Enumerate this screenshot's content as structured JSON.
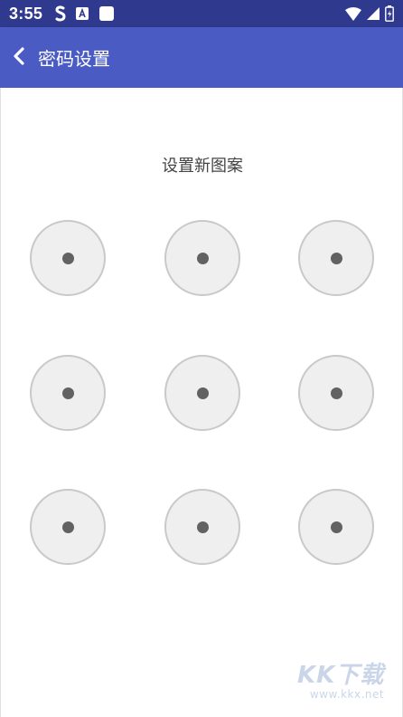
{
  "status_bar": {
    "time": "3:55",
    "left_icons": [
      "s-app-icon",
      "a-app-icon",
      "square-app-icon"
    ],
    "right_icons": [
      "wifi-icon",
      "signal-icon",
      "battery-icon"
    ],
    "color": "#2f3a8f"
  },
  "app_bar": {
    "title": "密码设置",
    "back_icon": "chevron-left-icon",
    "color": "#4a5bc4"
  },
  "pattern": {
    "prompt": "设置新图案",
    "rows": 3,
    "cols": 3,
    "node_fill": "#efefef",
    "node_border": "#c9c9c9",
    "dot_color": "#626262"
  },
  "watermark": {
    "logo": "KK下载",
    "url": "www.kkx.net"
  }
}
